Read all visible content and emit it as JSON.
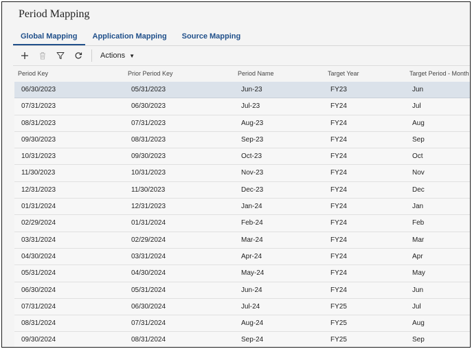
{
  "page": {
    "title": "Period Mapping"
  },
  "tabs": [
    {
      "label": "Global Mapping",
      "active": true
    },
    {
      "label": "Application Mapping",
      "active": false
    },
    {
      "label": "Source Mapping",
      "active": false
    }
  ],
  "toolbar": {
    "icons": [
      "add-icon",
      "delete-icon",
      "filter-icon",
      "refresh-icon"
    ],
    "actions_label": "Actions"
  },
  "columns": [
    "Period Key",
    "Prior Period Key",
    "Period Name",
    "Target Year",
    "Target Period - Month"
  ],
  "rows": [
    [
      "06/30/2023",
      "05/31/2023",
      "Jun-23",
      "FY23",
      "Jun"
    ],
    [
      "07/31/2023",
      "06/30/2023",
      "Jul-23",
      "FY24",
      "Jul"
    ],
    [
      "08/31/2023",
      "07/31/2023",
      "Aug-23",
      "FY24",
      "Aug"
    ],
    [
      "09/30/2023",
      "08/31/2023",
      "Sep-23",
      "FY24",
      "Sep"
    ],
    [
      "10/31/2023",
      "09/30/2023",
      "Oct-23",
      "FY24",
      "Oct"
    ],
    [
      "11/30/2023",
      "10/31/2023",
      "Nov-23",
      "FY24",
      "Nov"
    ],
    [
      "12/31/2023",
      "11/30/2023",
      "Dec-23",
      "FY24",
      "Dec"
    ],
    [
      "01/31/2024",
      "12/31/2023",
      "Jan-24",
      "FY24",
      "Jan"
    ],
    [
      "02/29/2024",
      "01/31/2024",
      "Feb-24",
      "FY24",
      "Feb"
    ],
    [
      "03/31/2024",
      "02/29/2024",
      "Mar-24",
      "FY24",
      "Mar"
    ],
    [
      "04/30/2024",
      "03/31/2024",
      "Apr-24",
      "FY24",
      "Apr"
    ],
    [
      "05/31/2024",
      "04/30/2024",
      "May-24",
      "FY24",
      "May"
    ],
    [
      "06/30/2024",
      "05/31/2024",
      "Jun-24",
      "FY24",
      "Jun"
    ],
    [
      "07/31/2024",
      "06/30/2024",
      "Jul-24",
      "FY25",
      "Jul"
    ],
    [
      "08/31/2024",
      "07/31/2024",
      "Aug-24",
      "FY25",
      "Aug"
    ],
    [
      "09/30/2024",
      "08/31/2024",
      "Sep-24",
      "FY25",
      "Sep"
    ]
  ],
  "selected_row": 0,
  "colors": {
    "accent": "#1f4f8a",
    "selected_row": "#dbe2ea",
    "background": "#f4f4f4"
  }
}
